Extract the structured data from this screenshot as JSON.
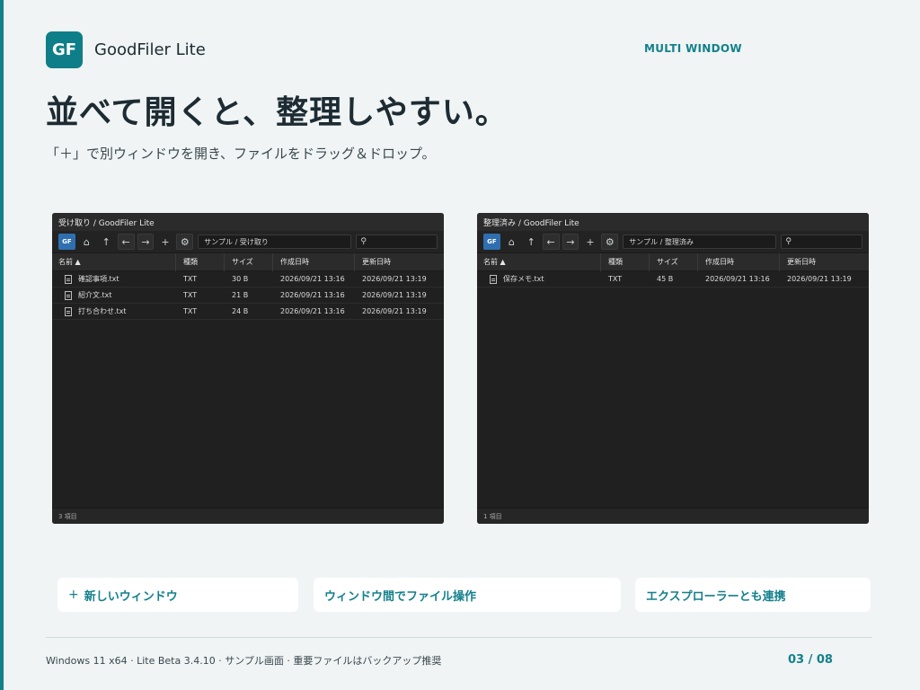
{
  "brand": {
    "logo": "GF",
    "name": "GoodFiler Lite"
  },
  "section_tag": "MULTI WINDOW",
  "headline": "並べて開くと、整理しやすい。",
  "subline": "「＋」で別ウィンドウを開き、ファイルをドラッグ＆ドロップ。",
  "columns": {
    "name": "名前 ▲",
    "kind": "種類",
    "size": "サイズ",
    "ctime": "作成日時",
    "mtime": "更新日時"
  },
  "toolbar": {
    "home_icon": "⌂",
    "up_icon": "↑",
    "back_icon": "←",
    "forward_icon": "→",
    "add_icon": "+",
    "settings_icon": "⚙",
    "search_icon": "⚲",
    "folder_icon": "GF"
  },
  "left_window": {
    "title": "受け取り / GoodFiler Lite",
    "address": "サンプル / 受け取り",
    "files": [
      {
        "name": "確認事項.txt",
        "kind": "TXT",
        "size": "30 B",
        "ctime": "2026/09/21 13:16",
        "mtime": "2026/09/21 13:19"
      },
      {
        "name": "紹介文.txt",
        "kind": "TXT",
        "size": "21 B",
        "ctime": "2026/09/21 13:16",
        "mtime": "2026/09/21 13:19"
      },
      {
        "name": "打ち合わせ.txt",
        "kind": "TXT",
        "size": "24 B",
        "ctime": "2026/09/21 13:16",
        "mtime": "2026/09/21 13:19"
      }
    ],
    "status": "3 項目"
  },
  "right_window": {
    "title": "整理済み / GoodFiler Lite",
    "address": "サンプル / 整理済み",
    "files": [
      {
        "name": "保存メモ.txt",
        "kind": "TXT",
        "size": "45 B",
        "ctime": "2026/09/21 13:16",
        "mtime": "2026/09/21 13:19"
      }
    ],
    "status": "1 項目"
  },
  "features": {
    "new_window_icon": "+",
    "new_window": "新しいウィンドウ",
    "between_windows": "ウィンドウ間でファイル操作",
    "explorer": "エクスプローラーとも連携"
  },
  "footer": {
    "info": "Windows 11 x64  ·  Lite Beta 3.4.10  ·  サンプル画面  ·  重要ファイルはバックアップ推奨",
    "page": "03 / 08"
  },
  "colors": {
    "accent": "#14808c",
    "window_bg": "#202020",
    "page_bg": "#f0f4f4"
  }
}
